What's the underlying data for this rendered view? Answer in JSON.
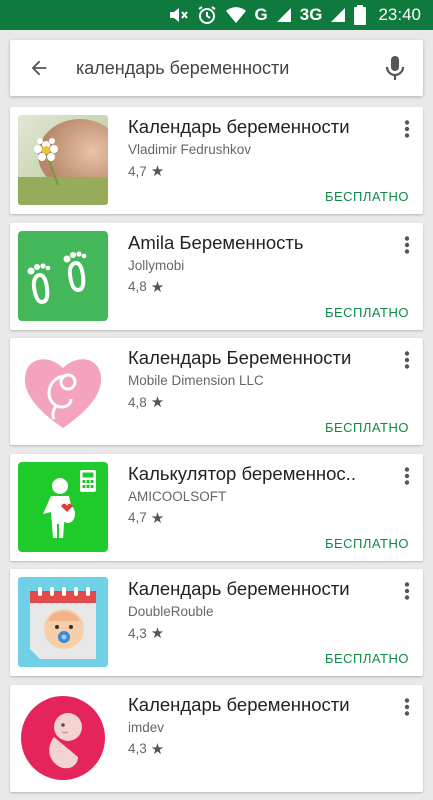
{
  "status_bar": {
    "icons": [
      "mute-icon",
      "alarm-icon",
      "wifi-icon",
      "signal-icon",
      "signal-icon",
      "battery-icon"
    ],
    "network_g": "G",
    "network_3g": "3G",
    "time": "23:40",
    "background_color": "#0e7a3e"
  },
  "search": {
    "query": "календарь беременности",
    "back_icon": "arrow-back-icon",
    "mic_icon": "mic-icon"
  },
  "accent_color": "#0e8a47",
  "apps": [
    {
      "title": "Календарь беременности",
      "developer": "Vladimir Fedrushkov",
      "rating": "4,7",
      "price": "БЕСПЛАТНО",
      "icon": "belly-flower-photo"
    },
    {
      "title": "Amila Беременность",
      "developer": "Jollymobi",
      "rating": "4,8",
      "price": "БЕСПЛАТНО",
      "icon": "footprints-icon"
    },
    {
      "title": "Календарь Беременности",
      "developer": "Mobile Dimension LLC",
      "rating": "4,8",
      "price": "БЕСПЛАТНО",
      "icon": "heart-embryo-icon"
    },
    {
      "title": "Калькулятор беременнос..",
      "developer": "AMICOOLSOFT",
      "rating": "4,7",
      "price": "БЕСПЛАТНО",
      "icon": "pregnant-calculator-icon"
    },
    {
      "title": "Календарь беременности",
      "developer": "DoubleRouble",
      "rating": "4,3",
      "price": "БЕСПЛАТНО",
      "icon": "calendar-baby-icon"
    },
    {
      "title": "Календарь беременности",
      "developer": "imdev",
      "rating": "4,3",
      "price": "",
      "icon": "embryo-circle-icon"
    }
  ]
}
